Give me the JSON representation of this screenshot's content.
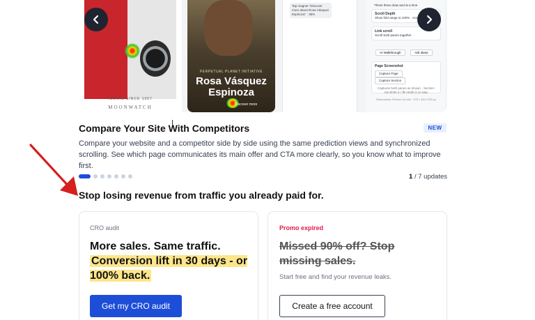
{
  "carousel": {
    "slide_a_caption_small": "ICONIC SINCE 1957",
    "slide_a_caption": "MOONWATCH",
    "slide_b_tag": "PERPETUAL PLANET INITIATIVE",
    "slide_b_name": "Rosa Vásquez Espinoza",
    "slide_b_cta": "Discover more",
    "slide_c_chat": "Tap magnet \"Discover more about Rosa Vásquez Espinoza\" · 38%",
    "slide_d": {
      "top_text": "These three draw and at a time",
      "scroll_depth_title": "Scroll Depth",
      "scroll_depth_sub": "Show fold range to 100% · scroll",
      "link_scroll_title": "Link scroll",
      "link_scroll_sub": "Scroll both panes together",
      "ai_walkthrough": "AI Walkthrough",
      "ab_ideas": "A/B Ideas",
      "page_screenshot_title": "Page Screenshot",
      "capture_page": "Capture Page",
      "capture_section": "Capture Section",
      "capture_note": "Captures both panes as shown · Section: Alt+Shift+2 / ⌘+Shift+2 on Mac",
      "dims_note": "Dimensions: iPhone 13 mini · 375 × 812 CSS px"
    }
  },
  "feature": {
    "title": "Compare Your Site With Competitors",
    "badge": "NEW",
    "description": "Compare your website and a competitor side by side using the same prediction views and synchronized scrolling. See which page communicates its main offer and CTA more clearly, so you know what to improve first."
  },
  "pagination": {
    "current": "1",
    "total_text": " / 7 updates",
    "dot_count": 7
  },
  "stop_title": "Stop losing revenue from traffic you already paid for.",
  "cards": {
    "left": {
      "kicker": "CRO audit",
      "headline_line1": "More sales. Same traffic.",
      "headline_highlight": "Conversion lift in 30 days - or 100% back.",
      "button": "Get my CRO audit"
    },
    "right": {
      "kicker": "Promo expired",
      "headline": "Missed 90% off? Stop missing sales.",
      "sub": "Start free and find your revenue leaks.",
      "button": "Create a free account"
    }
  },
  "colors": {
    "accent": "#1d4ed8",
    "promo_red": "#e11d48",
    "highlight": "#fde68a",
    "arrow": "#d61f1f"
  }
}
